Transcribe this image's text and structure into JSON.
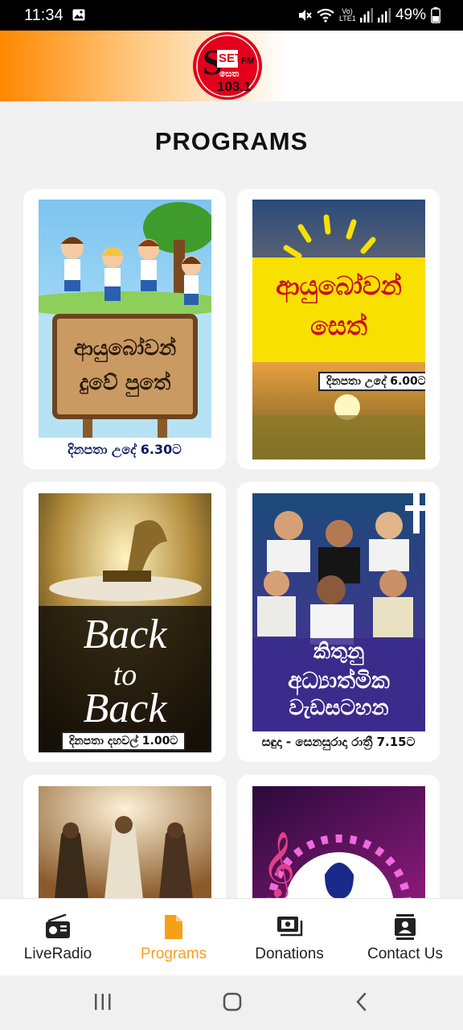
{
  "status_bar": {
    "time": "11:34",
    "battery": "49%",
    "network_label": "Vo) LTE1",
    "icons": [
      "gallery-icon",
      "mute-icon",
      "wifi-icon",
      "signal-icon",
      "signal-icon",
      "battery-icon"
    ]
  },
  "header": {
    "logo_text_top": "SETH",
    "logo_text_fm": "FM",
    "logo_text_sinhala": "සෙත",
    "logo_text_freq": "103.1",
    "brand_color": "#e4001b"
  },
  "page_title": "PROGRAMS",
  "programs": [
    {
      "art_title_line1": "ආයුබෝවන්",
      "art_title_line2": "දුවේ පුතේ",
      "schedule": "දිනපතා උදේ 6.30ට"
    },
    {
      "art_title_line1": "ආයුබෝවන්",
      "art_title_line2": "සෙත්",
      "schedule": "දිනපතා උදේ 6.00ට"
    },
    {
      "art_title_line1": "Back",
      "art_title_line2": "to",
      "art_title_line3": "Back",
      "schedule": "දිනපතා දහවල් 1.00ට"
    },
    {
      "art_title_line1": "කිතුනු",
      "art_title_line2": "අධ්‍යාත්මික",
      "art_title_line3": "වැඩසටහන",
      "schedule": "සඳුදා - සෙනසුරාදා රාත්‍රී 7.15ට"
    },
    {},
    {}
  ],
  "bottom_nav": [
    {
      "label": "LiveRadio",
      "icon": "radio-icon"
    },
    {
      "label": "Programs",
      "icon": "document-icon",
      "active": true
    },
    {
      "label": "Donations",
      "icon": "donation-icon"
    },
    {
      "label": "Contact Us",
      "icon": "contact-icon"
    }
  ],
  "colors": {
    "accent": "#f6a01a",
    "header_orange": "#ff8800",
    "caption_navy": "#0c1860"
  }
}
